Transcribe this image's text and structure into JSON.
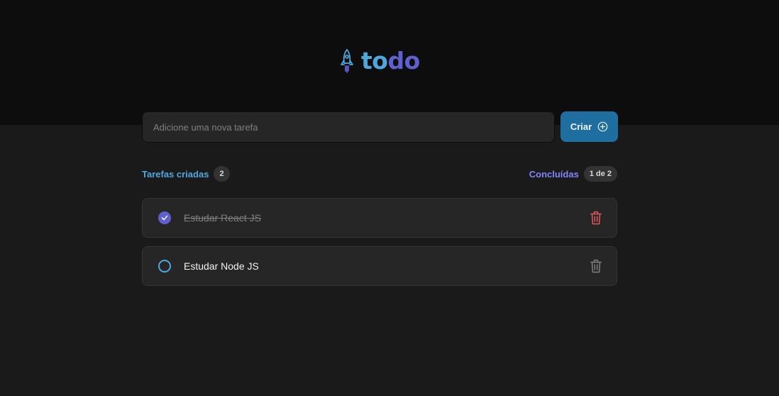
{
  "app": {
    "logo_part1": "to",
    "logo_part2": "do",
    "icon": "rocket-icon",
    "colors": {
      "blue": "#4ea8de",
      "purple": "#5e60ce",
      "danger": "#e25858"
    }
  },
  "search": {
    "placeholder": "Adicione uma nova tarefa",
    "value": "",
    "button_label": "Criar",
    "button_icon": "plus-circle-icon"
  },
  "stats": {
    "created_label": "Tarefas criadas",
    "created_count": "2",
    "done_label": "Concluídas",
    "done_count": "1 de 2"
  },
  "tasks": [
    {
      "text": "Estudar React JS",
      "completed": true,
      "delete_icon": "trash-icon"
    },
    {
      "text": "Estudar Node JS",
      "completed": false,
      "delete_icon": "trash-icon"
    }
  ]
}
